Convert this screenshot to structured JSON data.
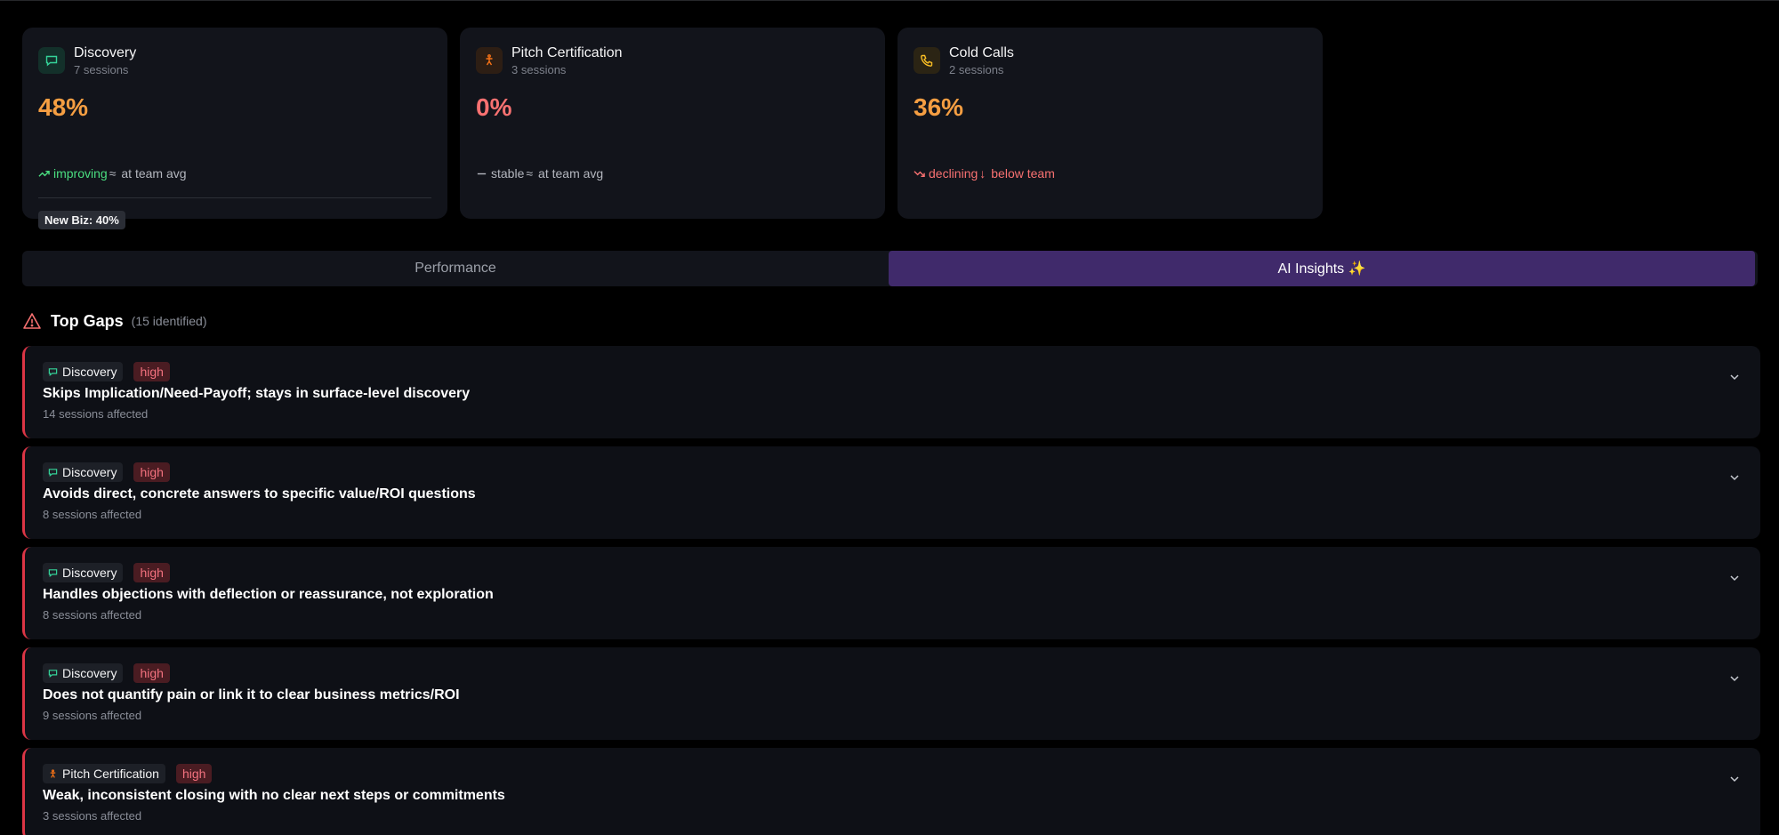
{
  "colors": {
    "pct_orange": "#f59e42",
    "pct_red": "#f87171",
    "improving_green": "#4ade80",
    "declining_red": "#f87171",
    "neutral_gray": "#b4b7bf",
    "accent_purple": "#402a6b",
    "discovery_green": "#34d399",
    "pitch_orange": "#f97316",
    "cold_yellow": "#fbbf24"
  },
  "cards": [
    {
      "icon": "chat-bubble-icon",
      "title": "Discovery",
      "sessions": "7 sessions",
      "pct": "48%",
      "trend_label": "improving",
      "team_symbol": "≈",
      "team_label": "at team avg",
      "badge": "New Biz: 40%"
    },
    {
      "icon": "person-figure-icon",
      "title": "Pitch Certification",
      "sessions": "3 sessions",
      "pct": "0%",
      "trend_label": "stable",
      "team_symbol": "≈",
      "team_label": "at team avg"
    },
    {
      "icon": "phone-icon",
      "title": "Cold Calls",
      "sessions": "2 sessions",
      "pct": "36%",
      "trend_label": "declining",
      "team_symbol": "↓",
      "team_label": "below team"
    }
  ],
  "tabs": [
    {
      "label": "Performance",
      "active": false
    },
    {
      "label": "AI Insights ✨",
      "active": true
    }
  ],
  "gaps_section": {
    "title": "Top Gaps",
    "count": "(15 identified)"
  },
  "gaps": [
    {
      "category": "Discovery",
      "severity": "high",
      "title": "Skips Implication/Need-Payoff; stays in surface-level discovery",
      "meta": "14 sessions affected"
    },
    {
      "category": "Discovery",
      "severity": "high",
      "title": "Avoids direct, concrete answers to specific value/ROI questions",
      "meta": "8 sessions affected"
    },
    {
      "category": "Discovery",
      "severity": "high",
      "title": "Handles objections with deflection or reassurance, not exploration",
      "meta": "8 sessions affected"
    },
    {
      "category": "Discovery",
      "severity": "high",
      "title": "Does not quantify pain or link it to clear business metrics/ROI",
      "meta": "9 sessions affected"
    },
    {
      "category": "Pitch Certification",
      "severity": "high",
      "title": "Weak, inconsistent closing with no clear next steps or commitments",
      "meta": "3 sessions affected"
    }
  ]
}
